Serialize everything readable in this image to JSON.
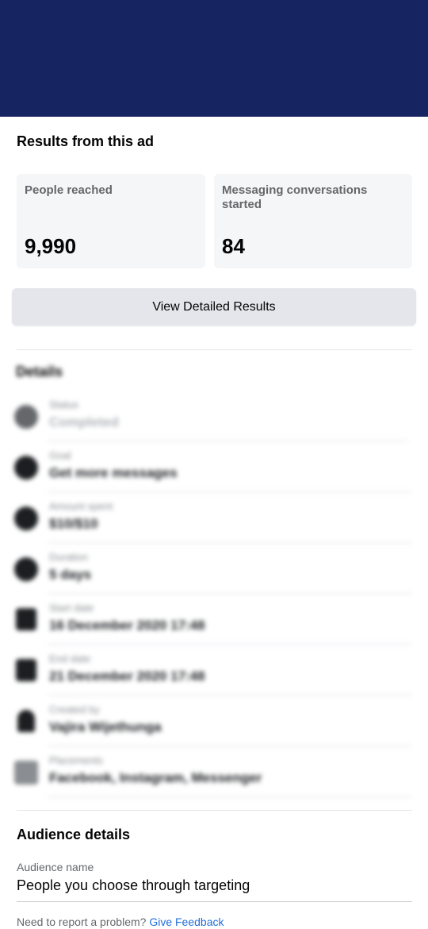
{
  "header": {
    "banner_color": "#172462"
  },
  "results": {
    "title": "Results from this ad",
    "metrics": [
      {
        "label": "People reached",
        "value": "9,990"
      },
      {
        "label": "Messaging conversations started",
        "value": "84"
      }
    ],
    "view_button": "View Detailed Results"
  },
  "details": {
    "title": "Details",
    "rows": [
      {
        "icon": "status-icon",
        "label": "Status",
        "value": "Completed"
      },
      {
        "icon": "chat-bubbles-icon",
        "label": "Goal",
        "value": "Get more messages"
      },
      {
        "icon": "dollar-coin-icon",
        "label": "Amount spent",
        "value": "$10/$10"
      },
      {
        "icon": "clock-icon",
        "label": "Duration",
        "value": "5 days"
      },
      {
        "icon": "calendar-icon",
        "label": "Start date",
        "value": "16 December 2020 17:48"
      },
      {
        "icon": "calendar-icon",
        "label": "End date",
        "value": "21 December 2020 17:48"
      },
      {
        "icon": "person-icon",
        "label": "Created by",
        "value": "Vajira Wijethunga"
      },
      {
        "icon": "placements-icon",
        "label": "Placements",
        "value": "Facebook, Instagram, Messenger"
      }
    ]
  },
  "audience": {
    "title": "Audience details",
    "name_label": "Audience name",
    "name_value": "People you choose through targeting"
  },
  "feedback": {
    "text": "Need to report a problem?",
    "link": "Give Feedback"
  },
  "colors": {
    "link": "#216fdb",
    "card_bg": "#f5f6f8",
    "button_bg": "#e4e6eb"
  }
}
